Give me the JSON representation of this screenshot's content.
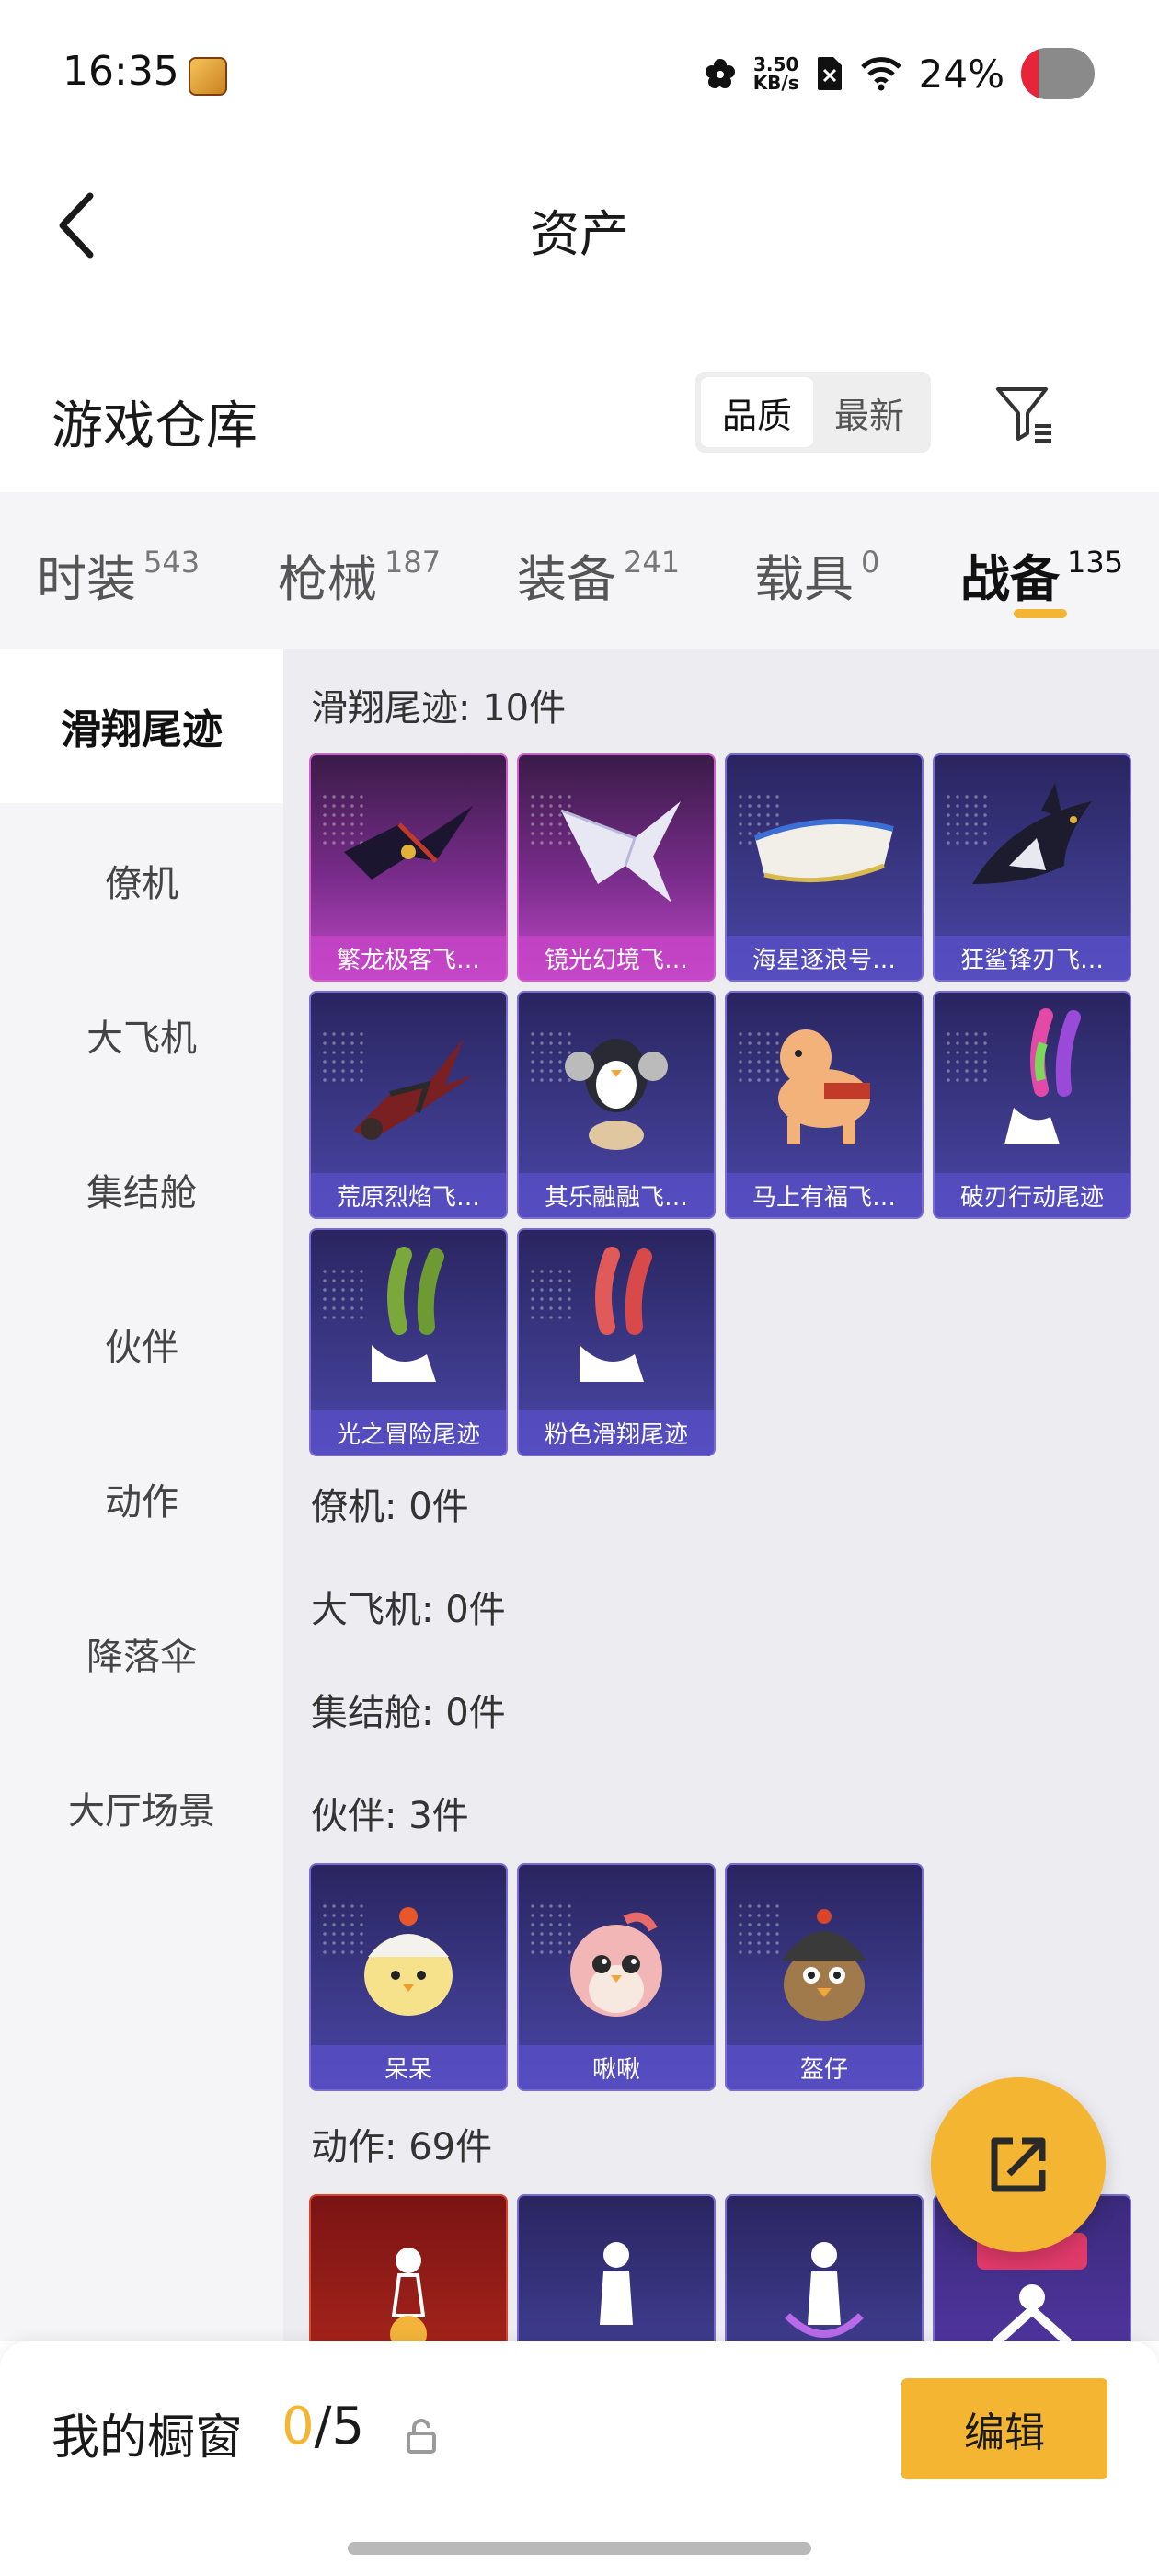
{
  "status_bar": {
    "time": "16:35",
    "speed_value": "3.50",
    "speed_unit": "KB/s",
    "battery": "24%",
    "battery_level": 0.24,
    "icons": [
      "app-icon",
      "flower-icon",
      "sim-off-icon",
      "wifi-icon",
      "battery-icon"
    ]
  },
  "header": {
    "title": "资产",
    "back_icon": "chevron-left-icon"
  },
  "warehouse": {
    "title": "游戏仓库",
    "sort_options": [
      "品质",
      "最新"
    ],
    "sort_selected": "品质",
    "filter_icon": "filter-icon"
  },
  "tabs": [
    {
      "label": "时装",
      "count": "543"
    },
    {
      "label": "枪械",
      "count": "187"
    },
    {
      "label": "装备",
      "count": "241"
    },
    {
      "label": "载具",
      "count": "0"
    },
    {
      "label": "战备",
      "count": "135",
      "active": true
    }
  ],
  "sidebar": {
    "items": [
      "滑翔尾迹",
      "僚机",
      "大飞机",
      "集结舱",
      "伙伴",
      "动作",
      "降落伞",
      "大厅场景"
    ],
    "active": "滑翔尾迹"
  },
  "sections": {
    "glide": {
      "title": "滑翔尾迹: 10件",
      "items": [
        "繁龙极客飞…",
        "镜光幻境飞…",
        "海星逐浪号…",
        "狂鲨锋刃飞…",
        "荒原烈焰飞…",
        "其乐融融飞…",
        "马上有福飞…",
        "破刃行动尾迹",
        "光之冒险尾迹",
        "粉色滑翔尾迹"
      ]
    },
    "wingman": {
      "title": "僚机: 0件"
    },
    "plane": {
      "title": "大飞机: 0件"
    },
    "capsule": {
      "title": "集结舱: 0件"
    },
    "partner": {
      "title": "伙伴: 3件",
      "items": [
        "呆呆",
        "啾啾",
        "盔仔"
      ]
    },
    "emote": {
      "title": "动作: 69件"
    }
  },
  "bottom": {
    "window_label": "我的橱窗",
    "count_current": "0",
    "count_sep_total": "/5",
    "edit_label": "编辑"
  },
  "colors": {
    "accent": "#f3b532",
    "card_purple": "#3d3a8a",
    "card_pink": "#c048c6"
  }
}
